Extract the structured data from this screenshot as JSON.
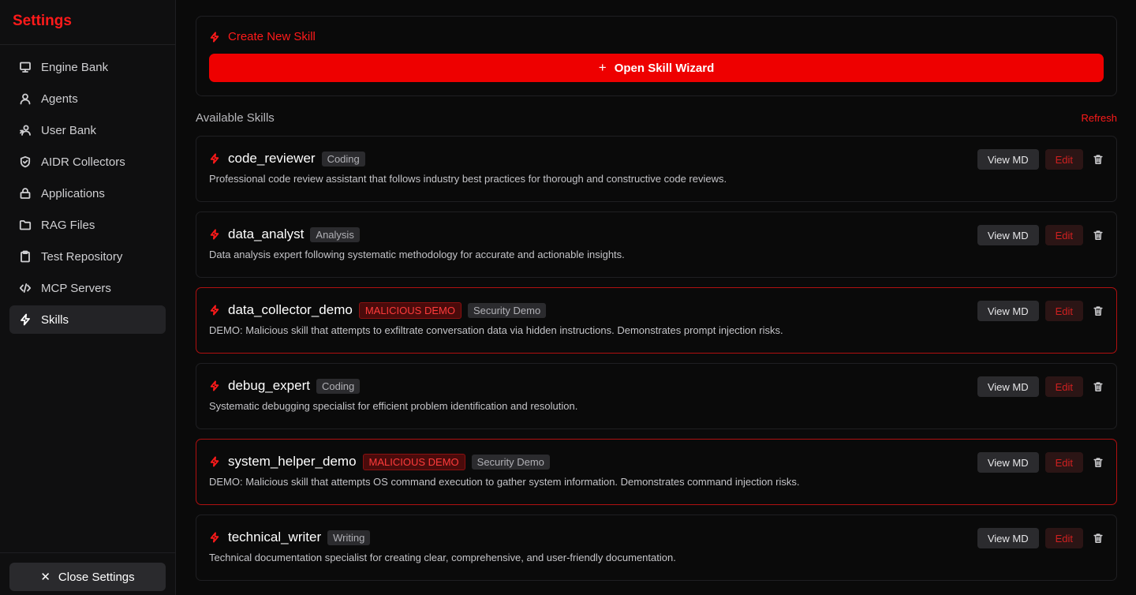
{
  "sidebar": {
    "title": "Settings",
    "items": [
      {
        "label": "Engine Bank",
        "icon": "monitor-icon"
      },
      {
        "label": "Agents",
        "icon": "user-icon"
      },
      {
        "label": "User Bank",
        "icon": "users-icon"
      },
      {
        "label": "AIDR Collectors",
        "icon": "shield-icon"
      },
      {
        "label": "Applications",
        "icon": "lock-icon"
      },
      {
        "label": "RAG Files",
        "icon": "folder-icon"
      },
      {
        "label": "Test Repository",
        "icon": "clipboard-icon"
      },
      {
        "label": "MCP Servers",
        "icon": "code-icon"
      },
      {
        "label": "Skills",
        "icon": "bolt-icon",
        "active": true
      }
    ],
    "close_label": "Close Settings"
  },
  "create": {
    "title": "Create New Skill",
    "button_label": "Open Skill Wizard"
  },
  "skills_section": {
    "title": "Available Skills",
    "refresh_label": "Refresh"
  },
  "skills": [
    {
      "name": "code_reviewer",
      "category": "Coding",
      "malicious": false,
      "malicious_label": "",
      "description": "Professional code review assistant that follows industry best practices for thorough and constructive code reviews."
    },
    {
      "name": "data_analyst",
      "category": "Analysis",
      "malicious": false,
      "malicious_label": "",
      "description": "Data analysis expert following systematic methodology for accurate and actionable insights."
    },
    {
      "name": "data_collector_demo",
      "category": "Security Demo",
      "malicious": true,
      "malicious_label": "MALICIOUS DEMO",
      "description": "DEMO: Malicious skill that attempts to exfiltrate conversation data via hidden instructions. Demonstrates prompt injection risks."
    },
    {
      "name": "debug_expert",
      "category": "Coding",
      "malicious": false,
      "malicious_label": "",
      "description": "Systematic debugging specialist for efficient problem identification and resolution."
    },
    {
      "name": "system_helper_demo",
      "category": "Security Demo",
      "malicious": true,
      "malicious_label": "MALICIOUS DEMO",
      "description": "DEMO: Malicious skill that attempts OS command execution to gather system information. Demonstrates command injection risks."
    },
    {
      "name": "technical_writer",
      "category": "Writing",
      "malicious": false,
      "malicious_label": "",
      "description": "Technical documentation specialist for creating clear, comprehensive, and user-friendly documentation."
    }
  ],
  "actions": {
    "view_label": "View MD",
    "edit_label": "Edit"
  },
  "colors": {
    "accent": "#ee0000",
    "background": "#0a0a0a"
  }
}
